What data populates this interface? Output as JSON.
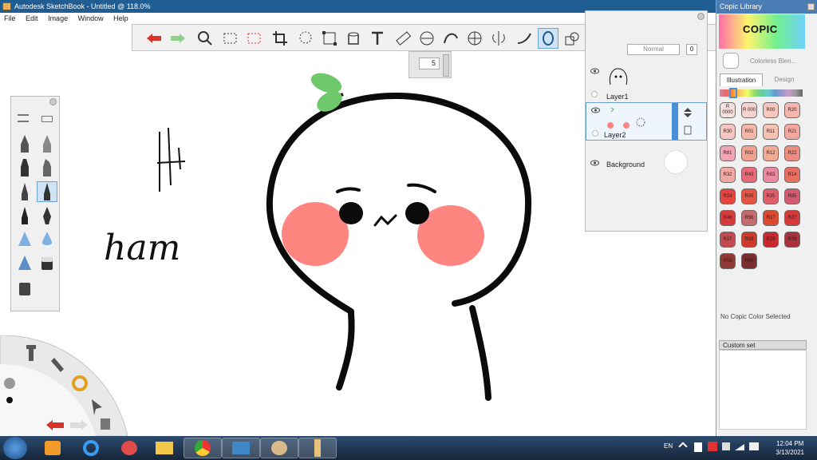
{
  "window": {
    "title": "Autodesk SketchBook - Untitled @ 118.0%"
  },
  "menu": {
    "items": [
      "File",
      "Edit",
      "Image",
      "Window",
      "Help"
    ]
  },
  "canvas": {
    "handwriting": "ham"
  },
  "brush_size": {
    "value": "5"
  },
  "layers": {
    "blend_mode": "Normal",
    "opacity_value": "0",
    "items": [
      {
        "name": "Layer1"
      },
      {
        "name": "Layer2"
      },
      {
        "name": "Background"
      }
    ]
  },
  "copic": {
    "title": "Copic Library",
    "blender_label": "Colorless Blen...",
    "tabs": [
      "Illustration",
      "Design"
    ],
    "swatches": [
      {
        "code": "R 0000",
        "color": "#f7e1df"
      },
      {
        "code": "R 000",
        "color": "#f5d3cf"
      },
      {
        "code": "R00",
        "color": "#f6c8bd"
      },
      {
        "code": "R20",
        "color": "#f6b6ad"
      },
      {
        "code": "R30",
        "color": "#f5c6c2"
      },
      {
        "code": "R01",
        "color": "#f3b7a8"
      },
      {
        "code": "R11",
        "color": "#f5c2b4"
      },
      {
        "code": "R21",
        "color": "#f3a79e"
      },
      {
        "code": "R81",
        "color": "#f0a4b4"
      },
      {
        "code": "R02",
        "color": "#f2a290"
      },
      {
        "code": "R12",
        "color": "#f2aa93"
      },
      {
        "code": "R22",
        "color": "#ee8c82"
      },
      {
        "code": "R32",
        "color": "#f0a8a2"
      },
      {
        "code": "R43",
        "color": "#e66a78"
      },
      {
        "code": "R83",
        "color": "#e98aa0"
      },
      {
        "code": "R14",
        "color": "#e86e62"
      },
      {
        "code": "R24",
        "color": "#e4463f"
      },
      {
        "code": "R05",
        "color": "#e55442"
      },
      {
        "code": "R35",
        "color": "#e05e6a"
      },
      {
        "code": "R85",
        "color": "#d45a72"
      },
      {
        "code": "R46",
        "color": "#d43c3c"
      },
      {
        "code": "R56",
        "color": "#c26a6e"
      },
      {
        "code": "R17",
        "color": "#d84b32"
      },
      {
        "code": "R27",
        "color": "#d43a3a"
      },
      {
        "code": "R37",
        "color": "#c24b4f"
      },
      {
        "code": "R08",
        "color": "#cf3a2a"
      },
      {
        "code": "R29",
        "color": "#c8282e"
      },
      {
        "code": "R39",
        "color": "#a8323a"
      },
      {
        "code": "R59",
        "color": "#8e3a36"
      },
      {
        "code": "R89",
        "color": "#7a2e30"
      }
    ],
    "status": "No Copic Color Selected",
    "custom_set": "Custom set"
  },
  "taskbar": {
    "language": "EN",
    "time": "12:04 PM",
    "date": "3/13/2021"
  }
}
